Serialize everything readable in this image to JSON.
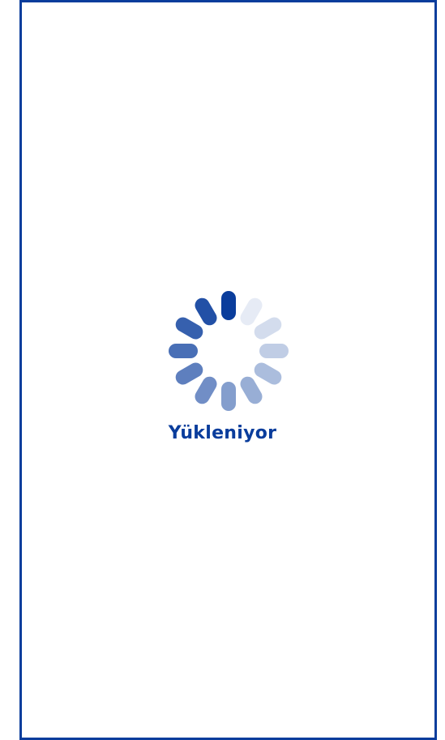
{
  "loading": {
    "label": "Yükleniyor"
  },
  "spinner": {
    "icon": "loading-spinner-icon",
    "color": "#0a3d9c",
    "segments": 12
  },
  "frame": {
    "border_color": "#0a3d9c"
  }
}
